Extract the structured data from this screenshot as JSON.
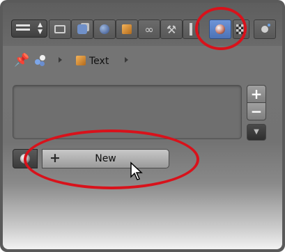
{
  "header": {
    "editor_type_icon": "editor-type-menu-icon",
    "tabs": [
      {
        "name": "render",
        "icon": "camera-icon"
      },
      {
        "name": "render-layers",
        "icon": "layers-icon"
      },
      {
        "name": "world",
        "icon": "world-icon"
      },
      {
        "name": "object",
        "icon": "object-cube-icon"
      },
      {
        "name": "constraints",
        "icon": "chain-link-icon"
      },
      {
        "name": "modifiers",
        "icon": "wrench-icon"
      },
      {
        "name": "data",
        "icon": "font-data-icon"
      },
      {
        "name": "material",
        "icon": "material-sphere-icon",
        "active": true
      },
      {
        "name": "texture",
        "icon": "checker-texture-icon"
      },
      {
        "name": "particles",
        "icon": "particles-icon"
      }
    ],
    "active_color": "#5a82c8"
  },
  "breadcrumb": {
    "object_label": "Text"
  },
  "material": {
    "new_label": "New",
    "add_symbol": "+",
    "remove_symbol": "−",
    "menu_symbol": "▼"
  },
  "annotations": {
    "highlight_color": "#d8121b"
  }
}
